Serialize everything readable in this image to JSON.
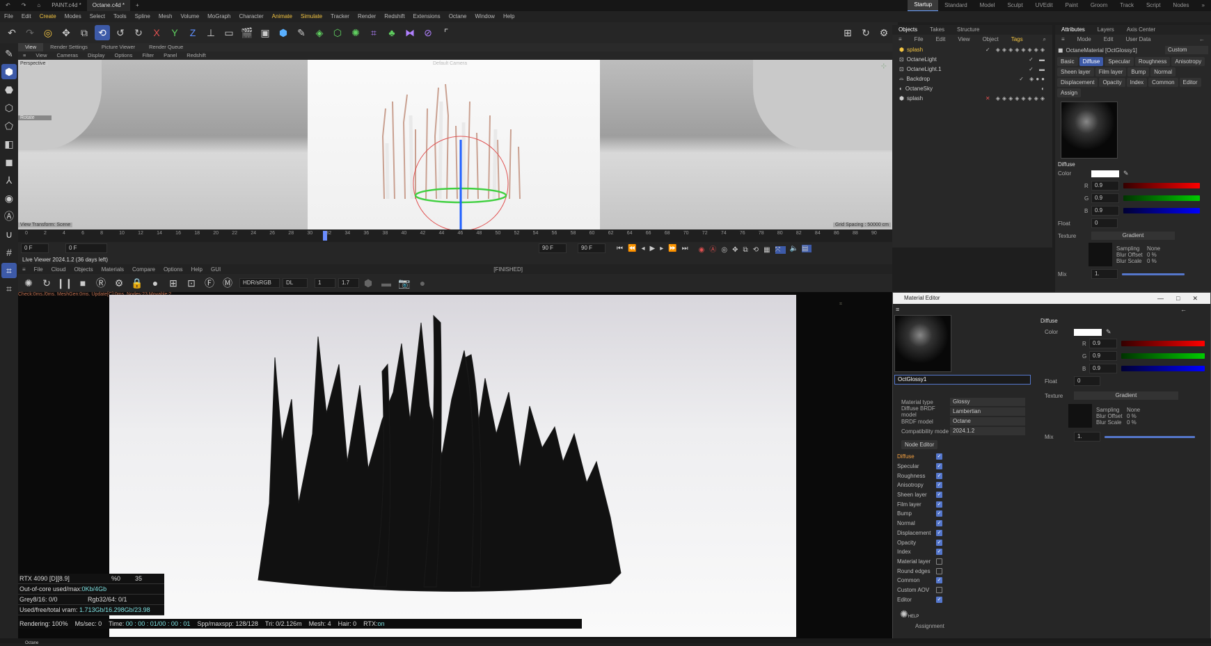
{
  "window": {
    "tabs": [
      "PAINT.c4d *",
      "Octane.c4d *"
    ],
    "add_tab": "+",
    "layouts": [
      "Startup",
      "Standard",
      "Model",
      "Sculpt",
      "UVEdit",
      "Paint",
      "Groom",
      "Track",
      "Script",
      "Nodes"
    ],
    "active_layout": "Startup"
  },
  "menubar": [
    "File",
    "Edit",
    "Create",
    "Modes",
    "Select",
    "Tools",
    "Spline",
    "Mesh",
    "Volume",
    "MoGraph",
    "Character",
    "Animate",
    "Simulate",
    "Tracker",
    "Render",
    "Redshift",
    "Extensions",
    "Octane",
    "Window",
    "Help"
  ],
  "viewport": {
    "tabs": [
      "View",
      "Render Settings",
      "Picture Viewer",
      "Render Queue"
    ],
    "menu": [
      "View",
      "Cameras",
      "Display",
      "Options",
      "Filter",
      "Panel",
      "Redshift"
    ],
    "perspective_label": "Perspective",
    "camera_label": "Default Camera",
    "rotate_label": "Rotate",
    "view_transform": "View Transform: Scene",
    "grid_spacing": "Grid Spacing : 50000 cm"
  },
  "timeline": {
    "ticks": [
      "0",
      "2",
      "4",
      "6",
      "8",
      "10",
      "12",
      "14",
      "16",
      "18",
      "20",
      "22",
      "24",
      "26",
      "28",
      "30",
      "32",
      "34",
      "36",
      "38",
      "40",
      "42",
      "44",
      "46",
      "48",
      "50",
      "52",
      "54",
      "56",
      "58",
      "60",
      "62",
      "64",
      "66",
      "68",
      "70",
      "72",
      "74",
      "76",
      "78",
      "80",
      "82",
      "84",
      "86",
      "88",
      "90"
    ],
    "current_frame": "0 F",
    "start_frame": "0 F",
    "end_frame": "90 F",
    "end_frame2": "90 F"
  },
  "live_viewer": {
    "title": "Live Viewer 2024.1.2 (36 days left)",
    "menu": [
      "File",
      "Cloud",
      "Objects",
      "Materials",
      "Compare",
      "Options",
      "Help",
      "GUI"
    ],
    "state": "[FINISHED]",
    "color_space": "HDR/sRGB",
    "kernel": "DL",
    "value_a": "1",
    "value_b": "1.7",
    "check_line": "Check:0ms./0ms. MeshGen:0ms. Update[C]:0ms. Nodes:23 Movable:2",
    "stats": {
      "gpu": "RTX 4090 [D][8.9]",
      "gpu_pct": "%0",
      "gpu_temp": "35",
      "ooc_label": "Out-of-core used/max:",
      "ooc_value": "0Kb/4Gb",
      "grey_label": "Grey8/16: 0/0",
      "rgb_label": "Rgb32/64: 0/1",
      "vram_label": "Used/free/total vram:",
      "vram_value": "1.713Gb/16.298Gb/23.98"
    },
    "status": {
      "rendering": "Rendering: 100%",
      "ms": "Ms/sec: 0",
      "time_label": "Time:",
      "time_value": "00 : 00 : 01/00 : 00 : 01",
      "spp": "Spp/maxspp: 128/128",
      "tri": "Tri: 0/2.126m",
      "mesh": "Mesh: 4",
      "hair": "Hair: 0",
      "rtx_label": "RTX:",
      "rtx_value": "on"
    }
  },
  "objects_panel": {
    "tabs": [
      "Objects",
      "Takes",
      "Structure"
    ],
    "menu": [
      "File",
      "Edit",
      "View",
      "Object",
      "Tags"
    ],
    "items": [
      {
        "name": "splash",
        "selected": true
      },
      {
        "name": "OctaneLight",
        "selected": false
      },
      {
        "name": "OctaneLight.1",
        "selected": false
      },
      {
        "name": "Backdrop",
        "selected": false
      },
      {
        "name": "OctaneSky",
        "selected": false
      },
      {
        "name": "splash",
        "selected": false
      }
    ]
  },
  "attributes": {
    "tabs": [
      "Attributes",
      "Layers",
      "Axis Center"
    ],
    "menu": [
      "Mode",
      "Edit",
      "User Data"
    ],
    "material": "OctaneMaterial [OctGlossy1]",
    "preset": "Custom",
    "chips_row1": [
      "Basic",
      "Diffuse",
      "Specular",
      "Roughness",
      "Anisotropy"
    ],
    "chips_row2": [
      "Sheen layer",
      "Film layer",
      "Bump",
      "Normal"
    ],
    "chips_row3": [
      "Displacement",
      "Opacity",
      "Index",
      "Common",
      "Editor"
    ],
    "chips_row4": [
      "Assign"
    ],
    "section": "Diffuse",
    "color_label": "Color",
    "r": "0.9",
    "g": "0.9",
    "b": "0.9",
    "float_label": "Float",
    "float_value": "0",
    "texture_label": "Texture",
    "texture_value": "Gradient",
    "sampling_label": "Sampling",
    "sampling_value": "None",
    "blur_offset_label": "Blur Offset",
    "blur_offset_value": "0 %",
    "blur_scale_label": "Blur Scale",
    "blur_scale_value": "0 %",
    "mix_label": "Mix",
    "mix_value": "1."
  },
  "material_editor": {
    "title": "Material Editor",
    "name": "OctGlossy1",
    "props": [
      {
        "label": "Material type",
        "value": "Glossy"
      },
      {
        "label": "Diffuse BRDF model",
        "value": "Lambertian"
      },
      {
        "label": "BRDF model",
        "value": "Octane"
      },
      {
        "label": "Compatibility mode",
        "value": "2024.1.2"
      }
    ],
    "node_editor": "Node Editor",
    "channels": [
      {
        "label": "Diffuse",
        "checked": true,
        "active": true
      },
      {
        "label": "Specular",
        "checked": true
      },
      {
        "label": "Roughness",
        "checked": true
      },
      {
        "label": "Anisotropy",
        "checked": true
      },
      {
        "label": "Sheen layer",
        "checked": true
      },
      {
        "label": "Film layer",
        "checked": true
      },
      {
        "label": "Bump",
        "checked": true
      },
      {
        "label": "Normal",
        "checked": true
      },
      {
        "label": "Displacement",
        "checked": true
      },
      {
        "label": "Opacity",
        "checked": true
      },
      {
        "label": "Index",
        "checked": true
      },
      {
        "label": "Material layer",
        "checked": false
      },
      {
        "label": "Round edges",
        "checked": false
      },
      {
        "label": "Common",
        "checked": true
      },
      {
        "label": "Custom AOV",
        "checked": false
      },
      {
        "label": "Editor",
        "checked": true
      }
    ],
    "help": "HELP",
    "assignment": "Assignment",
    "section": "Diffuse",
    "color_label": "Color",
    "r": "0.9",
    "g": "0.9",
    "b": "0.9",
    "float_label": "Float",
    "float_value": "0",
    "texture_label": "Texture",
    "texture_value": "Gradient",
    "sampling_label": "Sampling",
    "sampling_value": "None",
    "blur_offset_label": "Blur Offset",
    "blur_offset_value": "0 %",
    "blur_scale_label": "Blur Scale",
    "blur_scale_value": "0 %",
    "mix_label": "Mix",
    "mix_value": "1."
  },
  "bottom": {
    "label": "Octane"
  },
  "colors": {
    "accent": "#3d5aa8",
    "highlight": "#f4c542",
    "cyan": "#7de0e0"
  }
}
